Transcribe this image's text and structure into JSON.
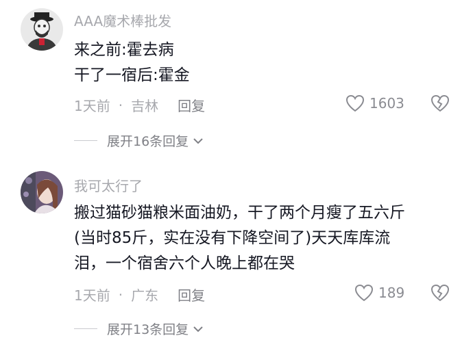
{
  "comments": [
    {
      "username": "AAA魔术棒批发",
      "lines": [
        "来之前:霍去病",
        "干了一宿后:霍金"
      ],
      "time": "1天前",
      "location": "吉林",
      "reply_label": "回复",
      "likes": "1603",
      "expand_label": "展开16条回复"
    },
    {
      "username": "我可太行了",
      "lines": [
        "搬过猫砂猫粮米面油奶，干了两个月瘦了五六斤",
        "(当时85斤，实在没有下降空间了)天天库库流",
        "泪，一个宿舍六个人晚上都在哭"
      ],
      "time": "1天前",
      "location": "广东",
      "reply_label": "回复",
      "likes": "189",
      "expand_label": "展开13条回复"
    }
  ],
  "icons": {
    "like": "heart-outline-icon",
    "dislike": "broken-heart-icon",
    "expand": "chevron-down-icon"
  }
}
